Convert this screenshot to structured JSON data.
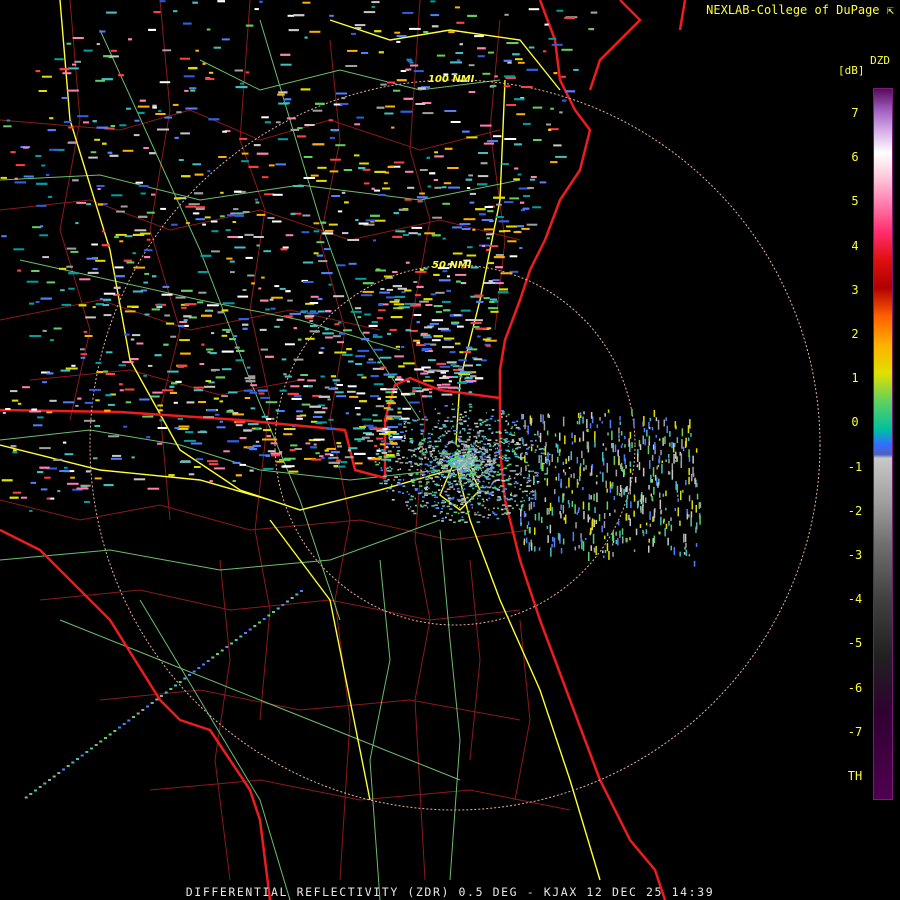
{
  "credit": "NEXLAB-College of DuPage",
  "legend": {
    "product": "DZD",
    "unit": "[dB]",
    "ticks": [
      "7",
      "6",
      "5",
      "4",
      "3",
      "2",
      "1",
      "0",
      "-1",
      "-2",
      "-3",
      "-4",
      "-5",
      "-6",
      "-7",
      "TH"
    ]
  },
  "range_rings": [
    {
      "label": "50 NMI",
      "nmi": 50
    },
    {
      "label": "100 NMI",
      "nmi": 100
    }
  ],
  "footer": "DIFFERENTIAL REFLECTIVITY (ZDR) 0.5 DEG - KJAX 12 DEC 25 14:39",
  "colors": {
    "background": "#000000",
    "state_border": "#ee1c1c",
    "county_border": "#8b1a1a",
    "highways": "#ffff33",
    "roads": "#7fe07f",
    "range_rings": "#e8b0a0",
    "text": "#ffff33"
  }
}
